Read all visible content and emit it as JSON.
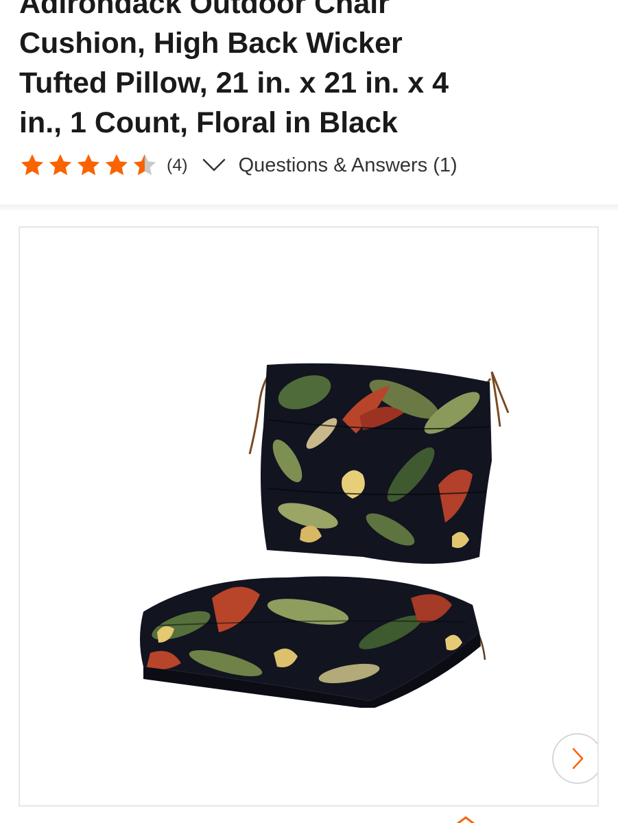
{
  "product": {
    "title_lines": [
      "Adirondack Outdoor Chair",
      "Cushion, High Back Wicker",
      "Tufted Pillow, 21 in. x 21 in. x 4",
      "in., 1 Count, Floral in Black"
    ]
  },
  "rating": {
    "stars": 4.5,
    "max_stars": 5,
    "review_count": "(4)",
    "star_color": "#f96302",
    "empty_star_color": "#c9c9c9",
    "expand_icon": "chevron-down-icon"
  },
  "qa": {
    "label": "Questions & Answers (1)"
  },
  "gallery": {
    "image_description_icon": "product-photo",
    "next_icon": "chevron-right-icon",
    "accent_color": "#f96302"
  }
}
